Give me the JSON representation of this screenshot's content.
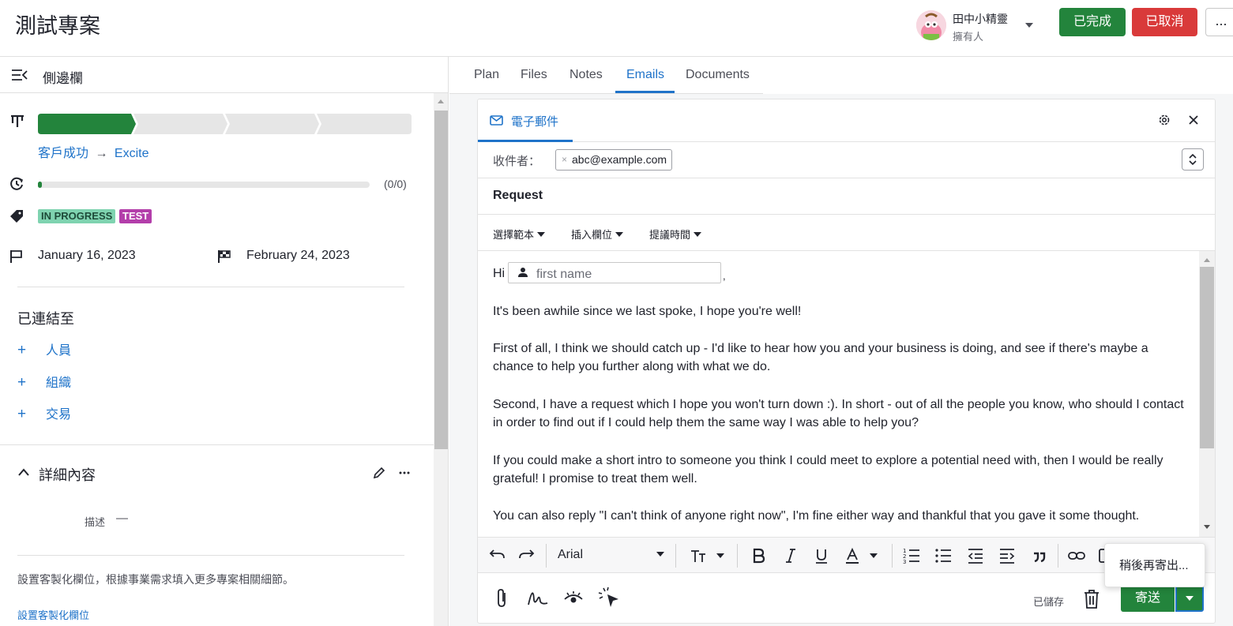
{
  "header": {
    "title": "測試專案",
    "owner_name": "田中小精靈",
    "owner_role": "擁有人",
    "won_label": "已完成",
    "lost_label": "已取消",
    "more_label": "..."
  },
  "sidebar": {
    "title": "側邊欄",
    "pipeline": {
      "stages_total": 4,
      "stages_done": 1,
      "label": "客戶成功",
      "arrow": "→",
      "stage": "Excite"
    },
    "progress": {
      "count": "(0/0)",
      "fraction": 0.0
    },
    "tags": [
      "IN PROGRESS",
      "TEST"
    ],
    "start_date": "January 16, 2023",
    "end_date": "February 24, 2023",
    "linked_heading": "已連結至",
    "linked_items": [
      {
        "plus": "+",
        "label": "人員"
      },
      {
        "plus": "+",
        "label": "組織"
      },
      {
        "plus": "+",
        "label": "交易"
      }
    ],
    "details_heading": "詳細內容",
    "description_label": "描述",
    "description_value": "—",
    "custom_fields_text": "設置客製化欄位，根據事業需求填入更多專案相關細節。",
    "custom_fields_link": "設置客製化欄位"
  },
  "tabs": [
    "Plan",
    "Files",
    "Notes",
    "Emails",
    "Documents"
  ],
  "active_tab": "Emails",
  "email": {
    "title": "電子郵件",
    "to_label": "收件者：",
    "to_chip_x": "×",
    "to_recipient": "abc@example.com",
    "subject": "Request",
    "toolbar": [
      "選擇範本",
      "插入欄位",
      "提議時間"
    ],
    "greeting": "Hi",
    "name_placeholder": "first name",
    "comma": ",",
    "paragraphs": [
      "It's been awhile since we last spoke, I hope you're well!",
      "First of all, I think we should catch up - I'd like to hear how you and your business is doing, and see if there's maybe a chance to help you further along with what we do.",
      "Second, I have a request which I hope you won't turn down :). In short - out of all the people you know, who should I contact in order to find out if I could help them the same way I was able to help you?",
      "If you could make a short intro to someone you think I could meet to explore a potential need with, then I would be really grateful! I promise to treat them well.",
      "You can also reply \"I can't think of anyone right now\", I'm fine either way and thankful that you gave it some thought."
    ],
    "font_name": "Arial",
    "saved_label": "已儲存",
    "send_label": "寄送",
    "send_later_label": "稍後再寄出..."
  },
  "colors": {
    "accent": "#1f73c9",
    "success": "#23843c",
    "danger": "#d93a3a",
    "tag_progress": "#7fd3b0",
    "tag_test": "#b33eaa"
  }
}
